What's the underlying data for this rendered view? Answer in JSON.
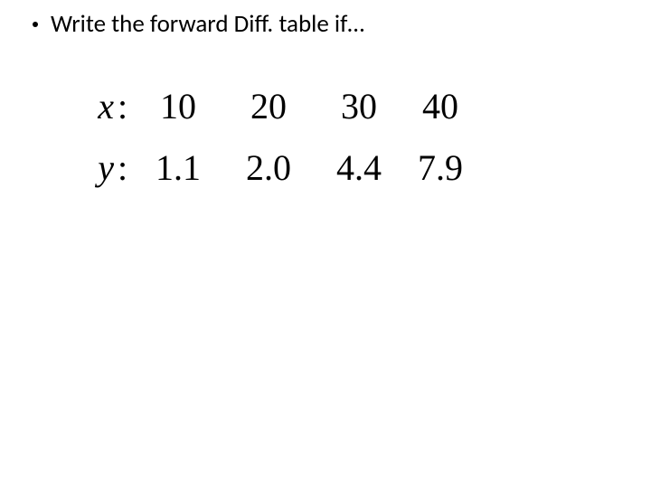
{
  "bullet_text": "Write the forward Diff. table if…",
  "table": {
    "rows": [
      {
        "label": "x",
        "values": [
          "10",
          "20",
          "30",
          "40"
        ]
      },
      {
        "label": "y",
        "values": [
          "1.1",
          "2.0",
          "4.4",
          "7.9"
        ]
      }
    ]
  },
  "chart_data": {
    "type": "table",
    "title": "Write the forward Diff. table if…",
    "columns": [
      "x",
      "y"
    ],
    "data": [
      {
        "x": 10,
        "y": 1.1
      },
      {
        "x": 20,
        "y": 2.0
      },
      {
        "x": 30,
        "y": 4.4
      },
      {
        "x": 40,
        "y": 7.9
      }
    ]
  }
}
